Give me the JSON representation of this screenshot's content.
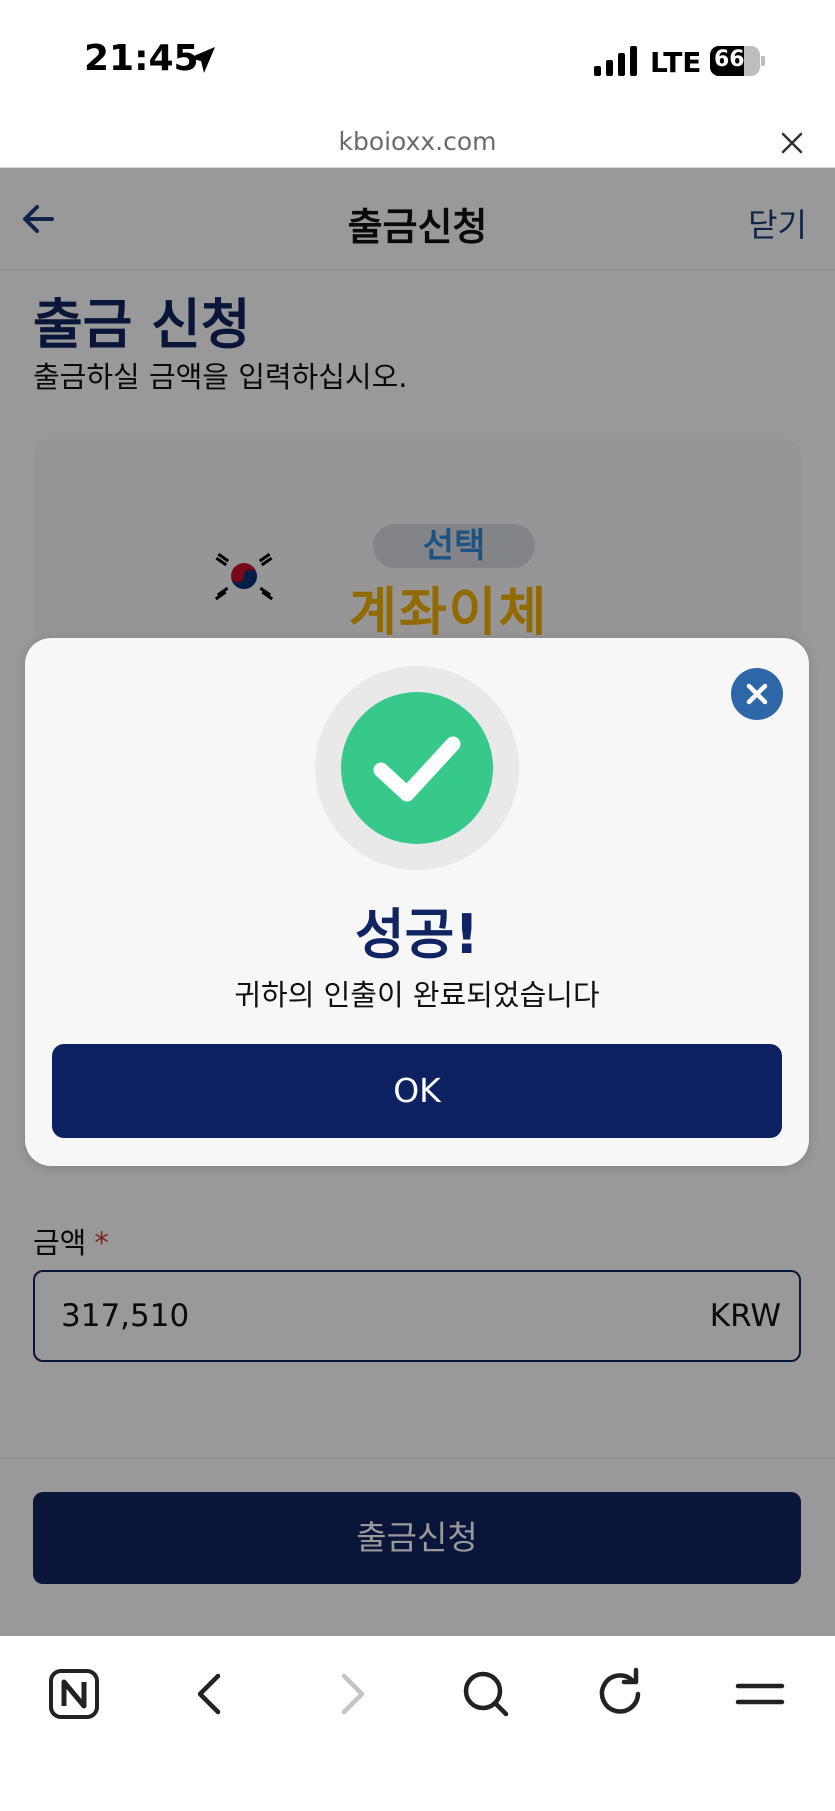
{
  "status_bar": {
    "time": "21:45",
    "network": "LTE",
    "battery": "66"
  },
  "browser": {
    "url": "kboioxx.com"
  },
  "page": {
    "header_title": "출금신청",
    "header_close": "닫기",
    "section_title": "출금 신청",
    "section_subtitle": "출금하실 금액을 입력하십시오.",
    "method_select_pill": "선택",
    "method_label": "계좌이체",
    "amount_label": "금액",
    "amount_required": "*",
    "amount_value": "317,510",
    "amount_unit": "KRW",
    "submit_label": "출금신청"
  },
  "modal": {
    "title": "성공!",
    "message": "귀하의 인출이 완료되었습니다",
    "ok_label": "OK"
  },
  "colors": {
    "primary_navy": "#0f2460",
    "success_green": "#36c98a",
    "close_blue": "#2e67a8",
    "method_yellow": "#f2b200"
  }
}
